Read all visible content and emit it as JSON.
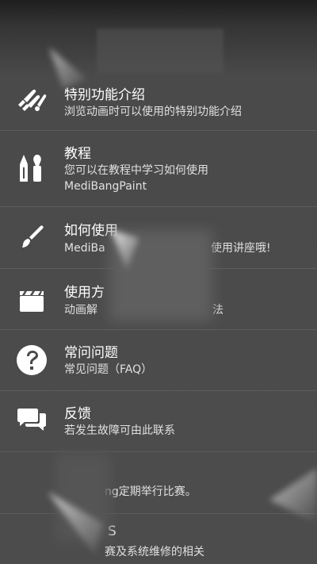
{
  "menu": {
    "items": [
      {
        "title": "特别功能介绍",
        "desc": "浏览动画时可以使用的特别功能介绍",
        "icon": "brushes-icon"
      },
      {
        "title": "教程",
        "desc_line1": "您可以在教程中学习如何使用",
        "desc_line2": "MediBangPaint",
        "icon": "pencil-brush-icon"
      },
      {
        "title": "如何使用",
        "desc_left": "MediBa",
        "desc_right": "使用讲座哦!",
        "icon": "paintbrush-icon"
      },
      {
        "title": "使用方",
        "desc_left": "动画解",
        "desc_right": "法",
        "icon": "clapperboard-icon"
      },
      {
        "title": "常问问题",
        "desc": "常见问题（FAQ）",
        "icon": "question-icon"
      },
      {
        "title": "反馈",
        "desc": "若发生故障可由此联系",
        "icon": "chat-bubbles-icon"
      },
      {
        "title": "",
        "desc": "ng定期举行比赛。",
        "icon": ""
      },
      {
        "title": "S",
        "desc": "赛及系统维修的相关",
        "icon": ""
      }
    ]
  }
}
